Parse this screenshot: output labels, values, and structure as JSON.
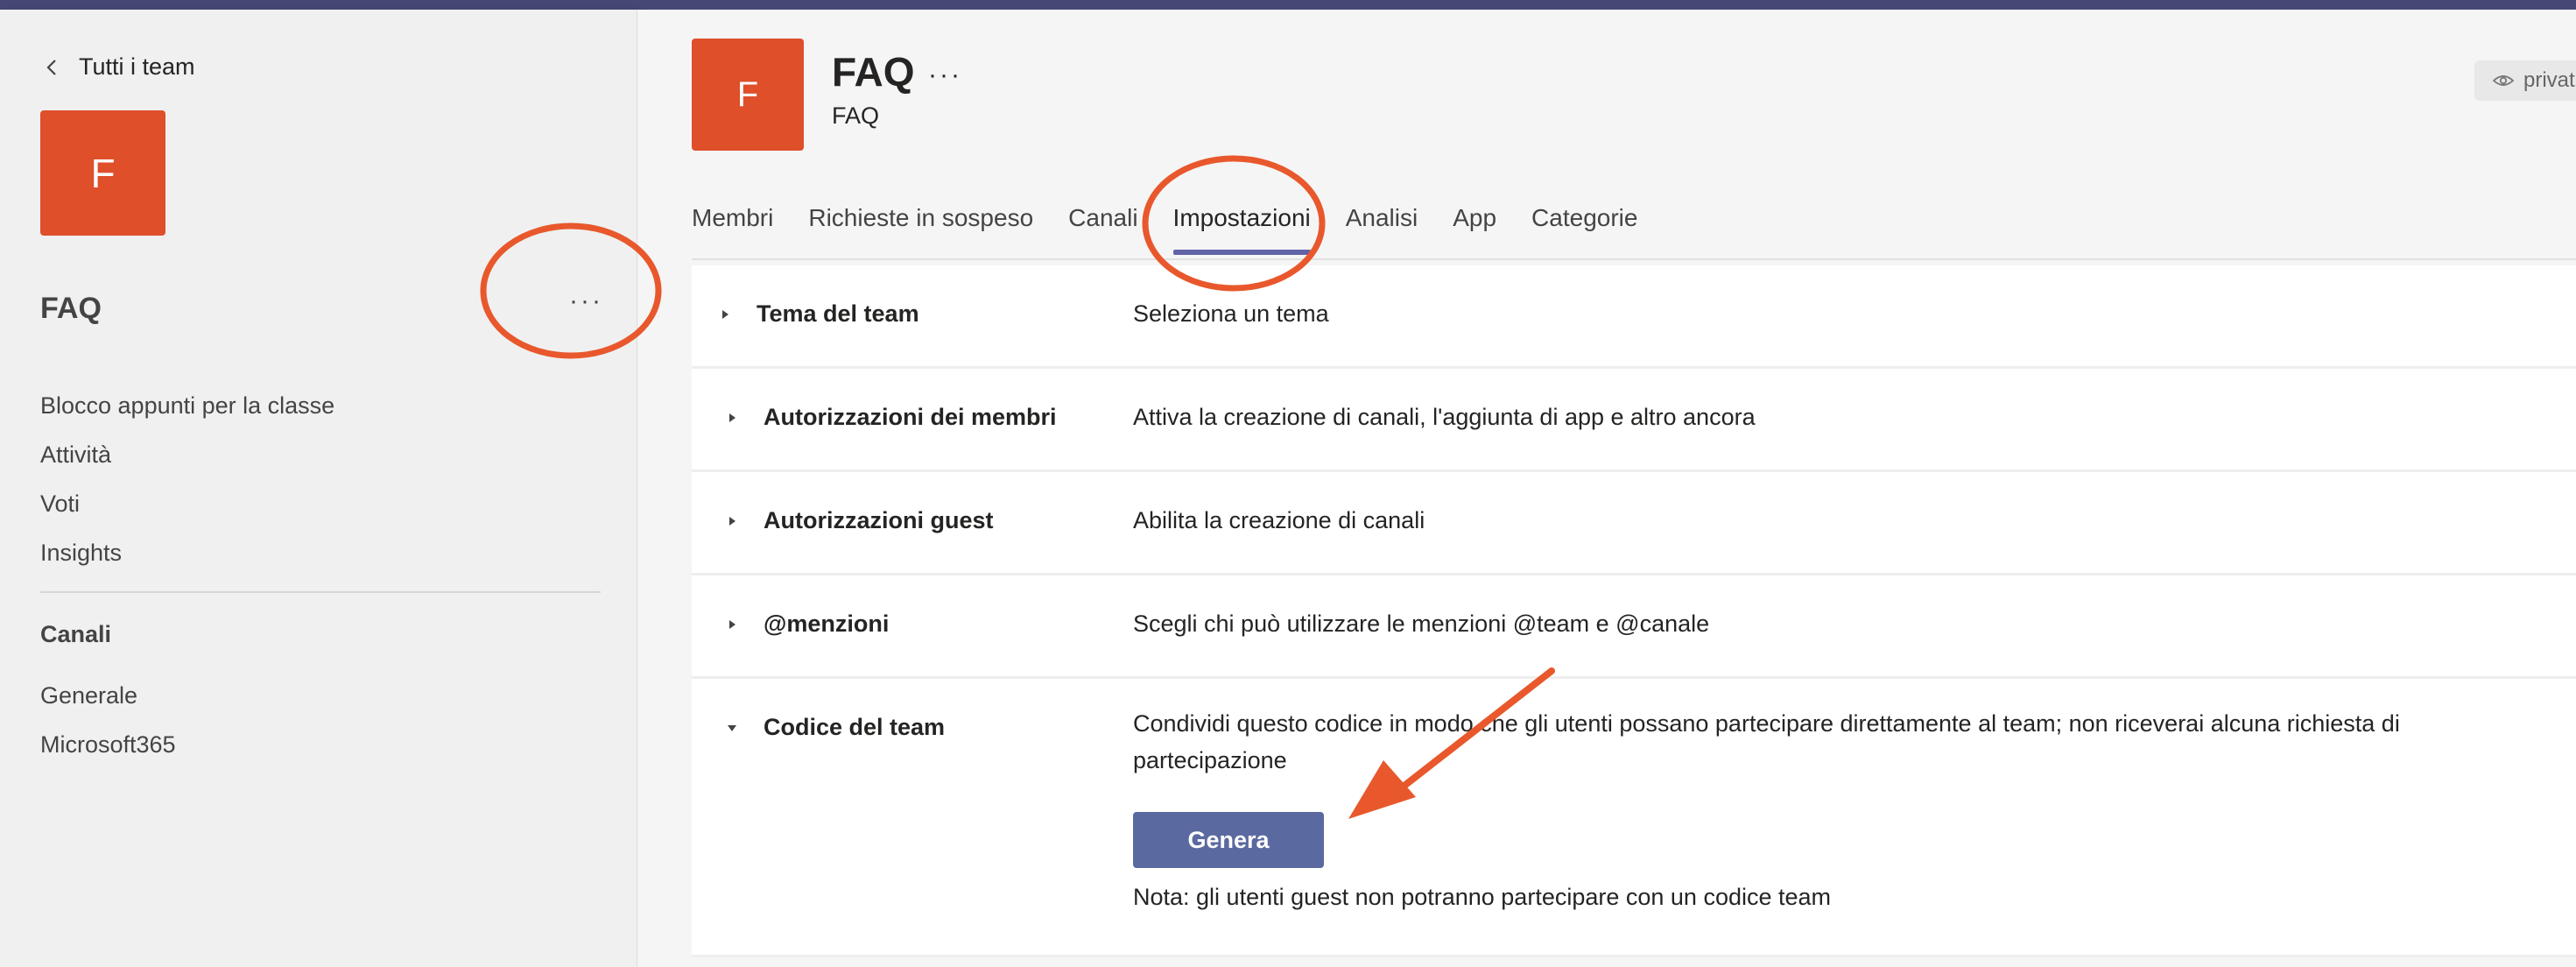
{
  "sidebar": {
    "back_label": "Tutti i team",
    "team_initial": "F",
    "team_name": "FAQ",
    "more_label": "···",
    "nav_items": [
      {
        "label": "Blocco appunti per la classe"
      },
      {
        "label": "Attività"
      },
      {
        "label": "Voti"
      },
      {
        "label": "Insights"
      }
    ],
    "channels_heading": "Canali",
    "channels": [
      {
        "label": "Generale"
      },
      {
        "label": "Microsoft365"
      }
    ]
  },
  "header": {
    "team_initial": "F",
    "title": "FAQ",
    "more_label": "···",
    "subtitle": "FAQ",
    "privacy_label": "privat"
  },
  "tabs": [
    {
      "label": "Membri"
    },
    {
      "label": "Richieste in sospeso"
    },
    {
      "label": "Canali"
    },
    {
      "label": "Impostazioni",
      "active": true
    },
    {
      "label": "Analisi"
    },
    {
      "label": "App"
    },
    {
      "label": "Categorie"
    }
  ],
  "settings": {
    "rows": [
      {
        "label": "Tema del team",
        "description": "Seleziona un tema"
      },
      {
        "label": "Autorizzazioni dei membri",
        "description": "Attiva la creazione di canali, l'aggiunta di app e altro ancora"
      },
      {
        "label": "Autorizzazioni guest",
        "description": "Abilita la creazione di canali"
      },
      {
        "label": "@menzioni",
        "description": "Scegli chi può utilizzare le menzioni @team e @canale"
      },
      {
        "label": "Codice del team",
        "description": "Condividi questo codice in modo che gli utenti possano partecipare direttamente al team; non riceverai alcuna richiesta di partecipazione"
      }
    ],
    "generate_label": "Genera",
    "note": "Nota: gli utenti guest non potranno partecipare con un codice team"
  },
  "colors": {
    "accent": "#6264a7",
    "tile": "#de4f2a",
    "button": "#5b69a1",
    "annotation": "#e8582c"
  }
}
